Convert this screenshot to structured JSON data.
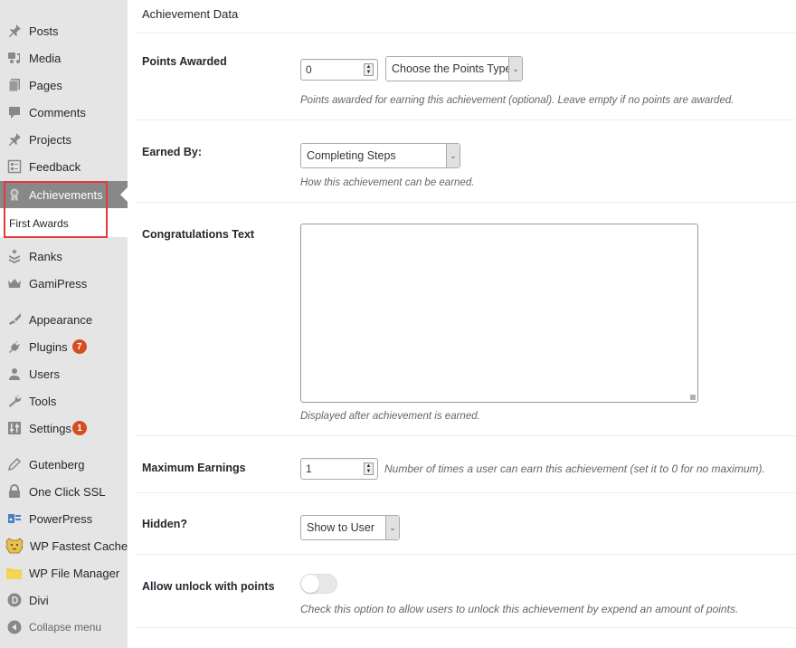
{
  "sidebar": {
    "items": [
      {
        "label": "Posts",
        "icon": "pushpin-icon"
      },
      {
        "label": "Media",
        "icon": "media-icon"
      },
      {
        "label": "Pages",
        "icon": "pages-icon"
      },
      {
        "label": "Comments",
        "icon": "comment-icon"
      },
      {
        "label": "Projects",
        "icon": "pushpin-icon"
      },
      {
        "label": "Feedback",
        "icon": "feedback-icon"
      },
      {
        "label": "Achievements",
        "icon": "award-icon",
        "active": true
      },
      {
        "label": "Ranks",
        "icon": "ranks-icon"
      },
      {
        "label": "GamiPress",
        "icon": "crown-icon"
      },
      {
        "label": "Appearance",
        "icon": "paintbrush-icon"
      },
      {
        "label": "Plugins",
        "icon": "plugin-icon",
        "badge": "7"
      },
      {
        "label": "Users",
        "icon": "user-icon"
      },
      {
        "label": "Tools",
        "icon": "wrench-icon"
      },
      {
        "label": "Settings",
        "icon": "settings-icon",
        "badge": "1"
      },
      {
        "label": "Gutenberg",
        "icon": "pencil-icon"
      },
      {
        "label": "One Click SSL",
        "icon": "lock-icon"
      },
      {
        "label": "PowerPress",
        "icon": "powerpress-icon"
      },
      {
        "label": "WP Fastest Cache",
        "icon": "cheetah-icon"
      },
      {
        "label": "WP File Manager",
        "icon": "folder-icon"
      },
      {
        "label": "Divi",
        "icon": "divi-icon"
      },
      {
        "label": "Collapse menu",
        "icon": "collapse-icon"
      }
    ],
    "submenu": {
      "label": "First Awards"
    },
    "colors": {
      "badge": "#d54e21",
      "highlight": "#e3393f",
      "active_bg": "#888888"
    }
  },
  "main": {
    "box_title": "Achievement Data",
    "points_awarded": {
      "label": "Points Awarded",
      "value": "0",
      "points_type": "Choose the Points Type",
      "description": "Points awarded for earning this achievement (optional). Leave empty if no points are awarded."
    },
    "earned_by": {
      "label": "Earned By:",
      "value": "Completing Steps",
      "description": "How this achievement can be earned."
    },
    "congratulations": {
      "label": "Congratulations Text",
      "value": "",
      "description": "Displayed after achievement is earned."
    },
    "maximum_earnings": {
      "label": "Maximum Earnings",
      "value": "1",
      "description": "Number of times a user can earn this achievement (set it to 0 for no maximum)."
    },
    "hidden": {
      "label": "Hidden?",
      "value": "Show to User"
    },
    "allow_unlock": {
      "label": "Allow unlock with points",
      "enabled": false,
      "description": "Check this option to allow users to unlock this achievement by expend an amount of points."
    }
  }
}
